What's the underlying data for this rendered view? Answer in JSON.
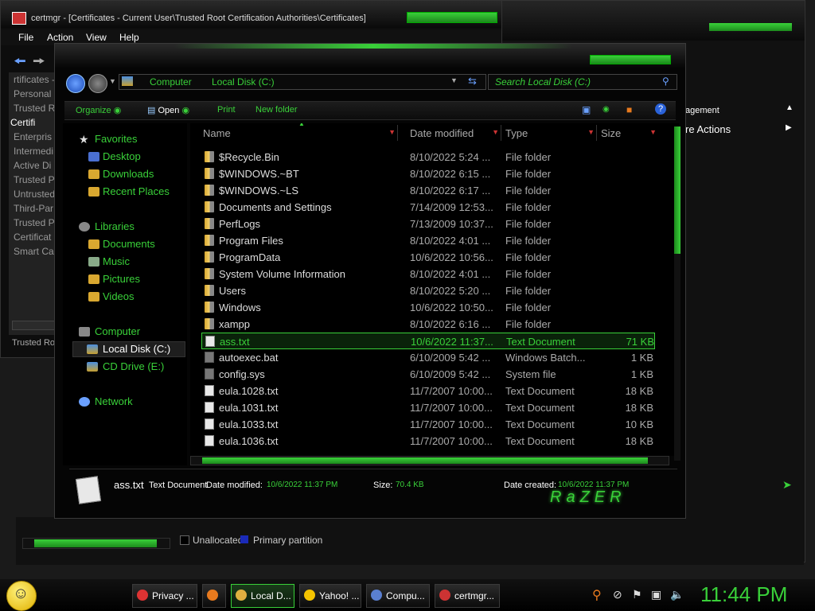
{
  "certmgr": {
    "title": "certmgr - [Certificates - Current User\\Trusted Root Certification Authorities\\Certificates]",
    "menu": [
      "File",
      "Action",
      "View",
      "Help"
    ],
    "tree": [
      "rtificates -",
      "Personal",
      "Trusted R",
      "Certifi",
      "Enterpris",
      "Intermedi",
      "Active Di",
      "Trusted P",
      "Untrusted",
      "Third-Par",
      "Trusted P",
      "Certificat",
      "Smart Ca"
    ],
    "status": "Trusted Ro"
  },
  "diskmgmt": {
    "actions_header": "agement",
    "more_actions": "re Actions",
    "legend": [
      "Unallocated",
      "Primary partition"
    ]
  },
  "explorer": {
    "breadcrumb": [
      "Computer",
      "Local Disk (C:)"
    ],
    "search_placeholder": "Search Local Disk (C:)",
    "toolbar": {
      "organize": "Organize",
      "open": "Open",
      "print": "Print",
      "new_folder": "New folder"
    },
    "nav": {
      "favorites": "Favorites",
      "desktop": "Desktop",
      "downloads": "Downloads",
      "recent": "Recent Places",
      "libraries": "Libraries",
      "documents": "Documents",
      "music": "Music",
      "pictures": "Pictures",
      "videos": "Videos",
      "computer": "Computer",
      "local_disk": "Local Disk (C:)",
      "cd_drive": "CD Drive (E:)",
      "network": "Network"
    },
    "columns": [
      "Name",
      "Date modified",
      "Type",
      "Size"
    ],
    "files": [
      {
        "name": "$Recycle.Bin",
        "date": "8/10/2022 5:24 ...",
        "type": "File folder",
        "size": "",
        "kind": "folder"
      },
      {
        "name": "$WINDOWS.~BT",
        "date": "8/10/2022 6:15 ...",
        "type": "File folder",
        "size": "",
        "kind": "folder"
      },
      {
        "name": "$WINDOWS.~LS",
        "date": "8/10/2022 6:17 ...",
        "type": "File folder",
        "size": "",
        "kind": "folder"
      },
      {
        "name": "Documents and Settings",
        "date": "7/14/2009 12:53...",
        "type": "File folder",
        "size": "",
        "kind": "folder"
      },
      {
        "name": "PerfLogs",
        "date": "7/13/2009 10:37...",
        "type": "File folder",
        "size": "",
        "kind": "folder"
      },
      {
        "name": "Program Files",
        "date": "8/10/2022 4:01 ...",
        "type": "File folder",
        "size": "",
        "kind": "folder"
      },
      {
        "name": "ProgramData",
        "date": "10/6/2022 10:56...",
        "type": "File folder",
        "size": "",
        "kind": "folder"
      },
      {
        "name": "System Volume Information",
        "date": "8/10/2022 4:01 ...",
        "type": "File folder",
        "size": "",
        "kind": "folder"
      },
      {
        "name": "Users",
        "date": "8/10/2022 5:20 ...",
        "type": "File folder",
        "size": "",
        "kind": "folder"
      },
      {
        "name": "Windows",
        "date": "10/6/2022 10:50...",
        "type": "File folder",
        "size": "",
        "kind": "folder"
      },
      {
        "name": "xampp",
        "date": "8/10/2022 6:16 ...",
        "type": "File folder",
        "size": "",
        "kind": "folder"
      },
      {
        "name": "ass.txt",
        "date": "10/6/2022 11:37...",
        "type": "Text Document",
        "size": "71 KB",
        "kind": "txt",
        "selected": true
      },
      {
        "name": "autoexec.bat",
        "date": "6/10/2009 5:42 ...",
        "type": "Windows Batch...",
        "size": "1 KB",
        "kind": "sys"
      },
      {
        "name": "config.sys",
        "date": "6/10/2009 5:42 ...",
        "type": "System file",
        "size": "1 KB",
        "kind": "sys"
      },
      {
        "name": "eula.1028.txt",
        "date": "11/7/2007 10:00...",
        "type": "Text Document",
        "size": "18 KB",
        "kind": "txt"
      },
      {
        "name": "eula.1031.txt",
        "date": "11/7/2007 10:00...",
        "type": "Text Document",
        "size": "18 KB",
        "kind": "txt"
      },
      {
        "name": "eula.1033.txt",
        "date": "11/7/2007 10:00...",
        "type": "Text Document",
        "size": "10 KB",
        "kind": "txt"
      },
      {
        "name": "eula.1036.txt",
        "date": "11/7/2007 10:00...",
        "type": "Text Document",
        "size": "18 KB",
        "kind": "txt"
      }
    ],
    "details": {
      "filename": "ass.txt",
      "type": "Text Document",
      "modified_label": "Date modified:",
      "modified_value": "10/6/2022 11:37 PM",
      "size_label": "Size:",
      "size_value": "70.4 KB",
      "created_label": "Date created:",
      "created_value": "10/6/2022 11:37 PM",
      "logo": "RaZER"
    }
  },
  "taskbar": {
    "tasks": [
      {
        "label": "Privacy ...",
        "color": "#d33"
      },
      {
        "label": "",
        "color": "#e87a1e"
      },
      {
        "label": "Local D...",
        "color": "#e0b040",
        "active": true
      },
      {
        "label": "Yahoo! ...",
        "color": "#f5c400"
      },
      {
        "label": "Compu...",
        "color": "#5a7fd0"
      },
      {
        "label": "certmgr...",
        "color": "#c33"
      }
    ],
    "clock": "11:44 PM"
  },
  "colors": {
    "accent": "#39d039",
    "background": "#000000"
  }
}
